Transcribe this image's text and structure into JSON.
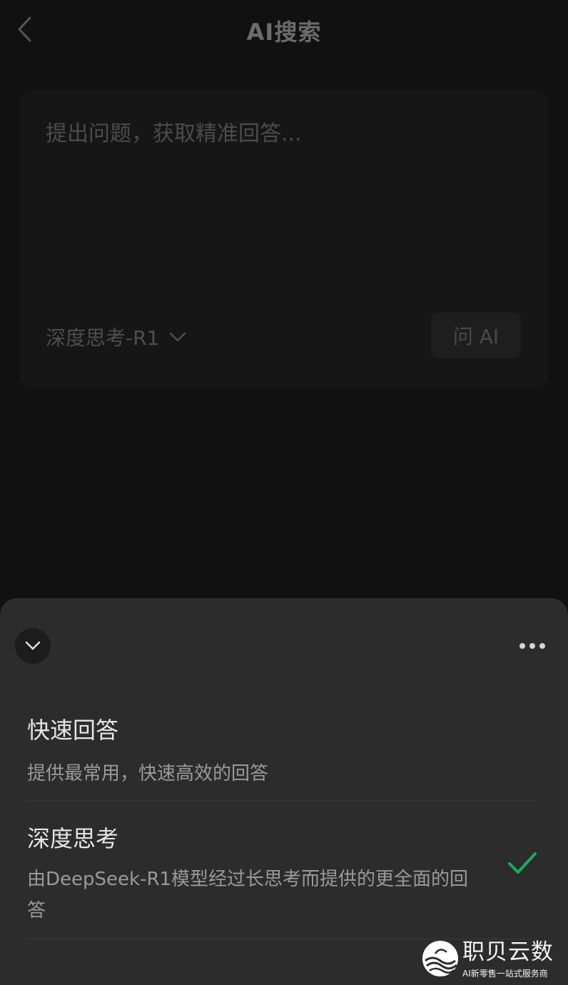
{
  "nav": {
    "title": "AI搜索"
  },
  "card": {
    "placeholder": "提出问题，获取精准回答...",
    "model_label": "深度思考-R1",
    "ask_button": "问 AI"
  },
  "sheet": {
    "options": [
      {
        "title": "快速回答",
        "description": "提供最常用，快速高效的回答",
        "selected": false
      },
      {
        "title": "深度思考",
        "description": "由DeepSeek-R1模型经过长思考而提供的更全面的回答",
        "selected": true
      }
    ]
  },
  "watermark": {
    "brand": "职贝云数",
    "tagline": "AI新零售一站式服务商"
  },
  "colors": {
    "accent_check": "#1aad5a",
    "sheet_background": "#2c2c2c",
    "page_background": "#111111"
  },
  "icons": {
    "back": "chevron-left-icon",
    "model_dropdown": "chevron-down-icon",
    "collapse": "chevron-down-icon",
    "more": "more-horizontal-icon",
    "selected": "checkmark-icon"
  }
}
